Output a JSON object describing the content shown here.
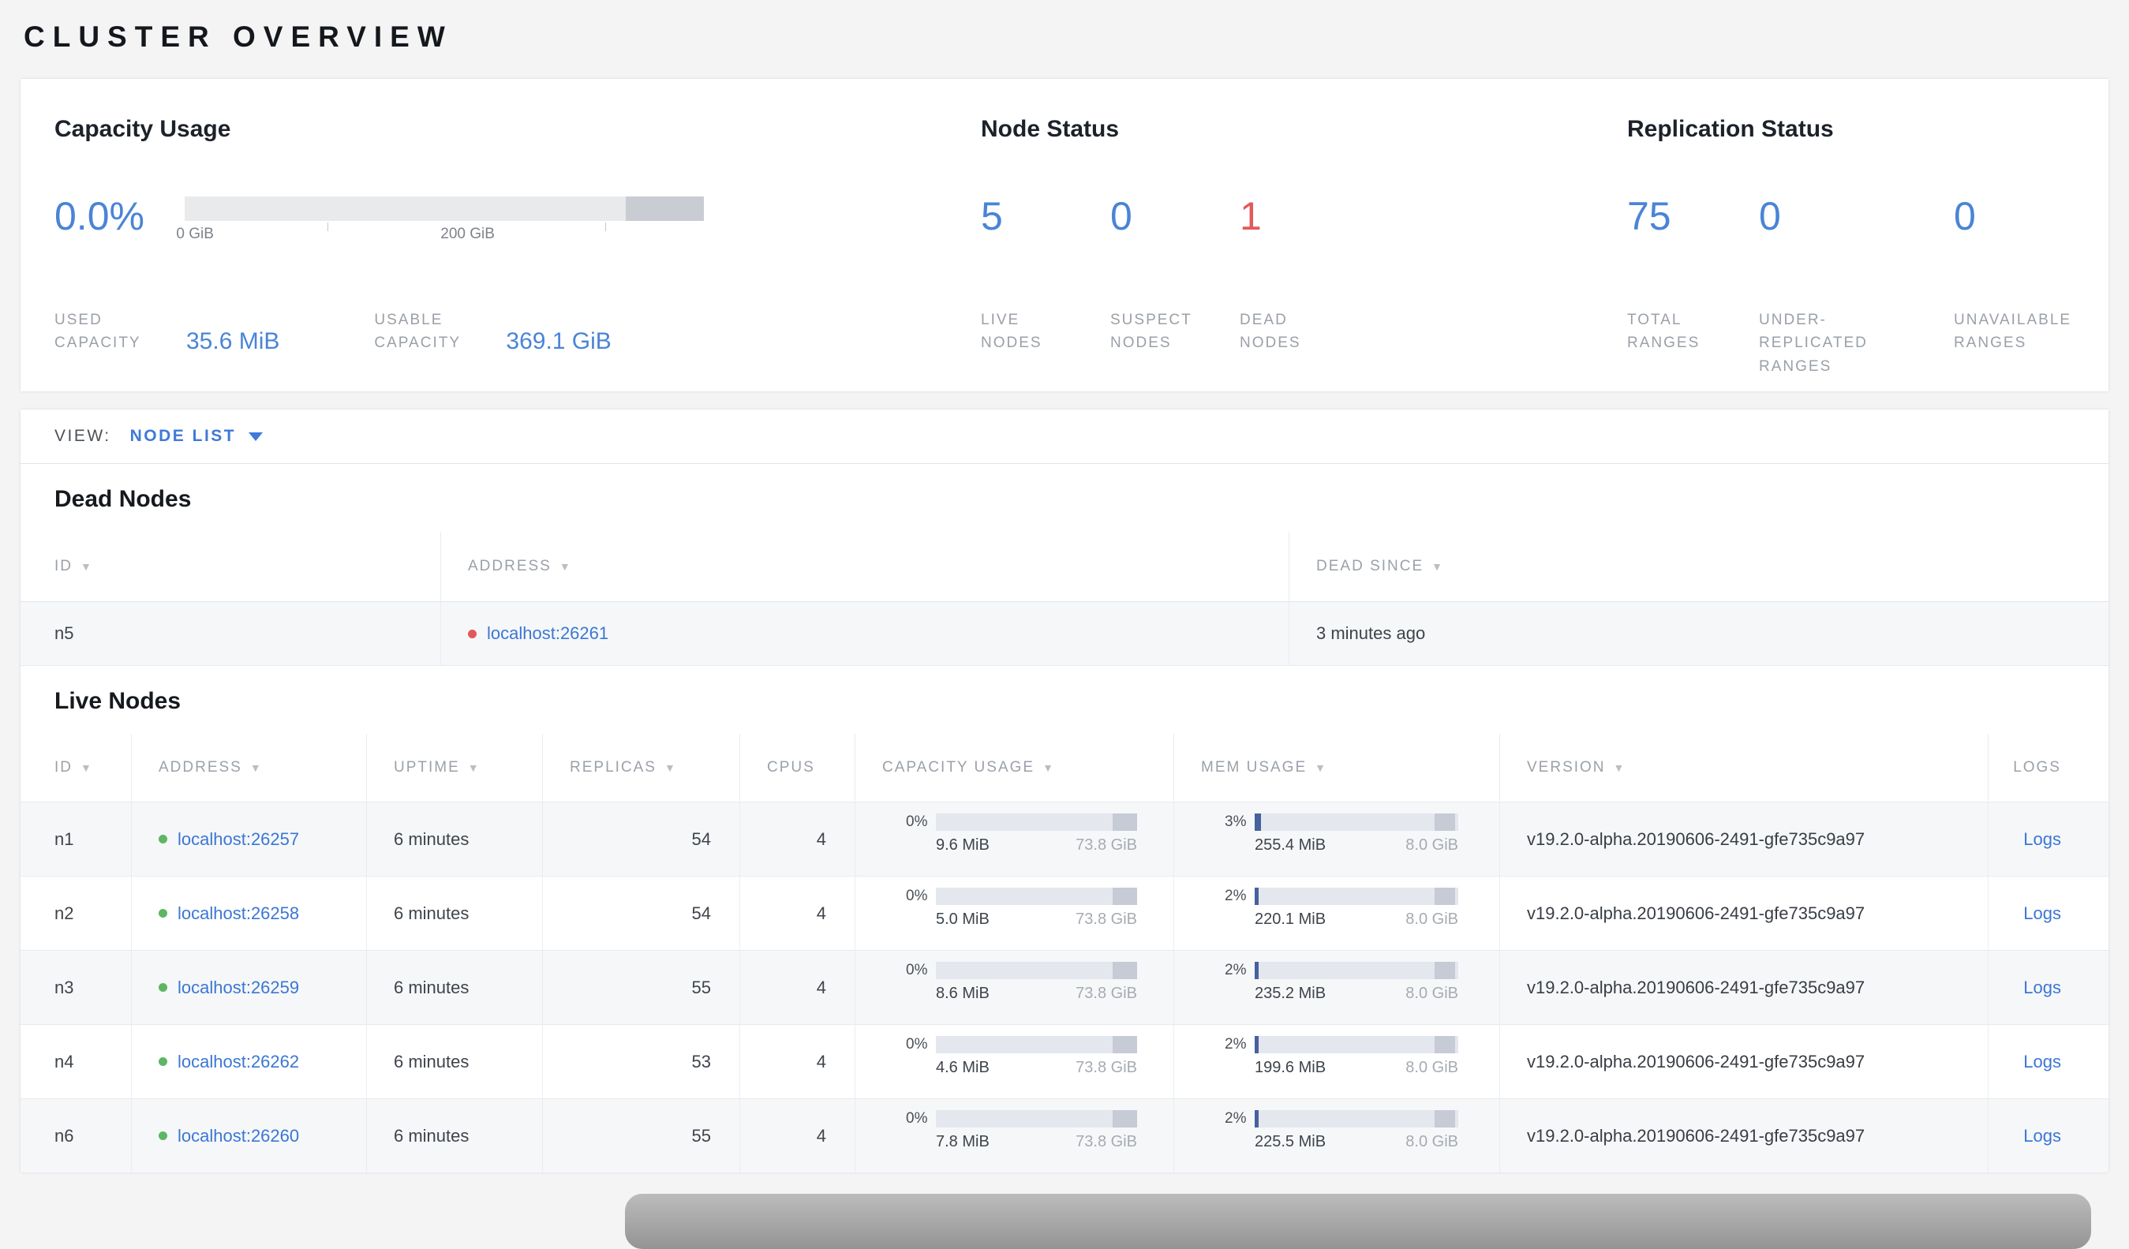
{
  "page": {
    "title": "CLUSTER OVERVIEW"
  },
  "icons": {
    "sort": "▼"
  },
  "colors": {
    "accent_blue": "#4a84d6",
    "link_blue": "#3b77d3",
    "danger_red": "#e2595c",
    "live_green": "#5eb664"
  },
  "summary": {
    "capacity": {
      "title": "Capacity Usage",
      "percent_label": "0.0%",
      "used_fraction_pct": 0,
      "axis_ticks": [
        "0 GiB",
        "200 GiB"
      ],
      "stats": [
        {
          "label": "USED\nCAPACITY",
          "value": "35.6 MiB"
        },
        {
          "label": "USABLE\nCAPACITY",
          "value": "369.1 GiB"
        }
      ]
    },
    "node_status": {
      "title": "Node Status",
      "stats": [
        {
          "value": "5",
          "label": "LIVE\nNODES"
        },
        {
          "value": "0",
          "label": "SUSPECT\nNODES"
        },
        {
          "value": "1",
          "label": "DEAD\nNODES"
        }
      ]
    },
    "replication": {
      "title": "Replication Status",
      "stats": [
        {
          "value": "75",
          "label": "TOTAL\nRANGES"
        },
        {
          "value": "0",
          "label": "UNDER-\nREPLICATED\nRANGES"
        },
        {
          "value": "0",
          "label": "UNAVAILABLE\nRANGES"
        }
      ]
    }
  },
  "view_bar": {
    "label": "VIEW:",
    "selected": "NODE LIST"
  },
  "dead_nodes": {
    "title": "Dead Nodes",
    "columns": [
      "ID",
      "ADDRESS",
      "DEAD SINCE"
    ],
    "rows": [
      {
        "id": "n5",
        "address": "localhost:26261",
        "dead_since": "3 minutes ago"
      }
    ]
  },
  "live_nodes": {
    "title": "Live Nodes",
    "columns": [
      "ID",
      "ADDRESS",
      "UPTIME",
      "REPLICAS",
      "CPUS",
      "CAPACITY USAGE",
      "MEM USAGE",
      "VERSION",
      "LOGS"
    ],
    "rows": [
      {
        "id": "n1",
        "address": "localhost:26257",
        "uptime": "6 minutes",
        "replicas": "54",
        "cpus": "4",
        "capacity": {
          "pct": "0%",
          "pct_num": 0,
          "used": "9.6 MiB",
          "total": "73.8 GiB"
        },
        "mem": {
          "pct": "3%",
          "pct_num": 3,
          "used": "255.4 MiB",
          "total": "8.0 GiB"
        },
        "version": "v19.2.0-alpha.20190606-2491-gfe735c9a97",
        "logs": "Logs"
      },
      {
        "id": "n2",
        "address": "localhost:26258",
        "uptime": "6 minutes",
        "replicas": "54",
        "cpus": "4",
        "capacity": {
          "pct": "0%",
          "pct_num": 0,
          "used": "5.0 MiB",
          "total": "73.8 GiB"
        },
        "mem": {
          "pct": "2%",
          "pct_num": 2,
          "used": "220.1 MiB",
          "total": "8.0 GiB"
        },
        "version": "v19.2.0-alpha.20190606-2491-gfe735c9a97",
        "logs": "Logs"
      },
      {
        "id": "n3",
        "address": "localhost:26259",
        "uptime": "6 minutes",
        "replicas": "55",
        "cpus": "4",
        "capacity": {
          "pct": "0%",
          "pct_num": 0,
          "used": "8.6 MiB",
          "total": "73.8 GiB"
        },
        "mem": {
          "pct": "2%",
          "pct_num": 2,
          "used": "235.2 MiB",
          "total": "8.0 GiB"
        },
        "version": "v19.2.0-alpha.20190606-2491-gfe735c9a97",
        "logs": "Logs"
      },
      {
        "id": "n4",
        "address": "localhost:26262",
        "uptime": "6 minutes",
        "replicas": "53",
        "cpus": "4",
        "capacity": {
          "pct": "0%",
          "pct_num": 0,
          "used": "4.6 MiB",
          "total": "73.8 GiB"
        },
        "mem": {
          "pct": "2%",
          "pct_num": 2,
          "used": "199.6 MiB",
          "total": "8.0 GiB"
        },
        "version": "v19.2.0-alpha.20190606-2491-gfe735c9a97",
        "logs": "Logs"
      },
      {
        "id": "n6",
        "address": "localhost:26260",
        "uptime": "6 minutes",
        "replicas": "55",
        "cpus": "4",
        "capacity": {
          "pct": "0%",
          "pct_num": 0,
          "used": "7.8 MiB",
          "total": "73.8 GiB"
        },
        "mem": {
          "pct": "2%",
          "pct_num": 2,
          "used": "225.5 MiB",
          "total": "8.0 GiB"
        },
        "version": "v19.2.0-alpha.20190606-2491-gfe735c9a97",
        "logs": "Logs"
      }
    ]
  }
}
